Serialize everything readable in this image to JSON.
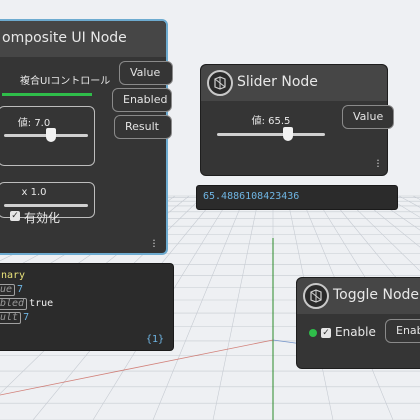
{
  "composite_node": {
    "title": "omposite UI Node",
    "control_group_label": "複合UIコントロール",
    "slider1": {
      "label": "値: 7.0",
      "level": 0.7
    },
    "slider2": {
      "label": "x 1.0",
      "level": 0.05
    },
    "checkbox_label": "有効化",
    "checkbox_checked": true,
    "ports": [
      "Value",
      "Enabled",
      "Result"
    ],
    "status_color": "#2fbd4a"
  },
  "slider_node": {
    "title": "Slider Node",
    "slider_label": "値: 65.5",
    "level": 0.655,
    "port": "Value",
    "watch_value": "65.4886108423436"
  },
  "toggle_node": {
    "title": "Toggle Node",
    "checkbox_label": "Enable",
    "checkbox_checked": true,
    "port": "Enabl",
    "status_color": "#2fbd4a"
  },
  "dict_preview": {
    "line1": "nary",
    "line2_tag": "ue",
    "line2_value": "7",
    "line3_tag": "bled",
    "line3_value": "true",
    "line4_tag": "ult",
    "line4_value": "7",
    "footer": "{1}"
  },
  "colors": {
    "selection": "#6dabd0",
    "node_body": "#353535",
    "node_header": "#464646",
    "watch_text": "#6fb5e3",
    "dict_key": "#e9e27a"
  },
  "icons": [
    "dynamo-node-icon",
    "kebab-menu-icon",
    "check-icon",
    "axis-lines"
  ]
}
